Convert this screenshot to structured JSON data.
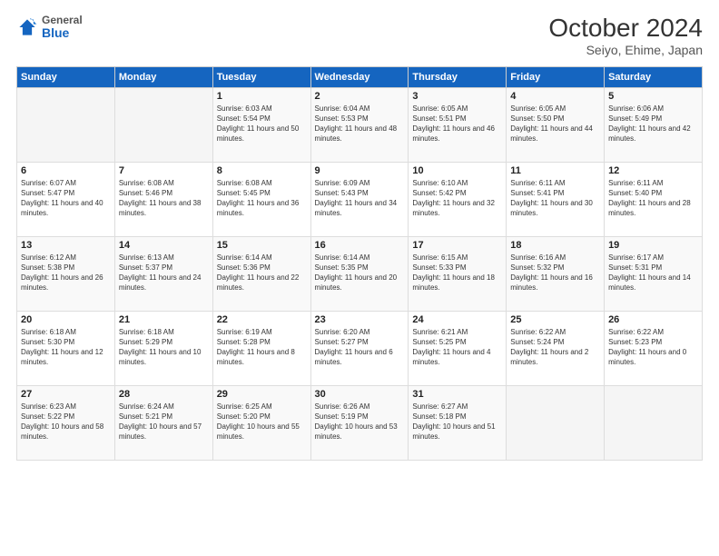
{
  "logo": {
    "general": "General",
    "blue": "Blue"
  },
  "title": "October 2024",
  "subtitle": "Seiyo, Ehime, Japan",
  "weekdays": [
    "Sunday",
    "Monday",
    "Tuesday",
    "Wednesday",
    "Thursday",
    "Friday",
    "Saturday"
  ],
  "weeks": [
    [
      {
        "day": "",
        "sunrise": "",
        "sunset": "",
        "daylight": ""
      },
      {
        "day": "",
        "sunrise": "",
        "sunset": "",
        "daylight": ""
      },
      {
        "day": "1",
        "sunrise": "Sunrise: 6:03 AM",
        "sunset": "Sunset: 5:54 PM",
        "daylight": "Daylight: 11 hours and 50 minutes."
      },
      {
        "day": "2",
        "sunrise": "Sunrise: 6:04 AM",
        "sunset": "Sunset: 5:53 PM",
        "daylight": "Daylight: 11 hours and 48 minutes."
      },
      {
        "day": "3",
        "sunrise": "Sunrise: 6:05 AM",
        "sunset": "Sunset: 5:51 PM",
        "daylight": "Daylight: 11 hours and 46 minutes."
      },
      {
        "day": "4",
        "sunrise": "Sunrise: 6:05 AM",
        "sunset": "Sunset: 5:50 PM",
        "daylight": "Daylight: 11 hours and 44 minutes."
      },
      {
        "day": "5",
        "sunrise": "Sunrise: 6:06 AM",
        "sunset": "Sunset: 5:49 PM",
        "daylight": "Daylight: 11 hours and 42 minutes."
      }
    ],
    [
      {
        "day": "6",
        "sunrise": "Sunrise: 6:07 AM",
        "sunset": "Sunset: 5:47 PM",
        "daylight": "Daylight: 11 hours and 40 minutes."
      },
      {
        "day": "7",
        "sunrise": "Sunrise: 6:08 AM",
        "sunset": "Sunset: 5:46 PM",
        "daylight": "Daylight: 11 hours and 38 minutes."
      },
      {
        "day": "8",
        "sunrise": "Sunrise: 6:08 AM",
        "sunset": "Sunset: 5:45 PM",
        "daylight": "Daylight: 11 hours and 36 minutes."
      },
      {
        "day": "9",
        "sunrise": "Sunrise: 6:09 AM",
        "sunset": "Sunset: 5:43 PM",
        "daylight": "Daylight: 11 hours and 34 minutes."
      },
      {
        "day": "10",
        "sunrise": "Sunrise: 6:10 AM",
        "sunset": "Sunset: 5:42 PM",
        "daylight": "Daylight: 11 hours and 32 minutes."
      },
      {
        "day": "11",
        "sunrise": "Sunrise: 6:11 AM",
        "sunset": "Sunset: 5:41 PM",
        "daylight": "Daylight: 11 hours and 30 minutes."
      },
      {
        "day": "12",
        "sunrise": "Sunrise: 6:11 AM",
        "sunset": "Sunset: 5:40 PM",
        "daylight": "Daylight: 11 hours and 28 minutes."
      }
    ],
    [
      {
        "day": "13",
        "sunrise": "Sunrise: 6:12 AM",
        "sunset": "Sunset: 5:38 PM",
        "daylight": "Daylight: 11 hours and 26 minutes."
      },
      {
        "day": "14",
        "sunrise": "Sunrise: 6:13 AM",
        "sunset": "Sunset: 5:37 PM",
        "daylight": "Daylight: 11 hours and 24 minutes."
      },
      {
        "day": "15",
        "sunrise": "Sunrise: 6:14 AM",
        "sunset": "Sunset: 5:36 PM",
        "daylight": "Daylight: 11 hours and 22 minutes."
      },
      {
        "day": "16",
        "sunrise": "Sunrise: 6:14 AM",
        "sunset": "Sunset: 5:35 PM",
        "daylight": "Daylight: 11 hours and 20 minutes."
      },
      {
        "day": "17",
        "sunrise": "Sunrise: 6:15 AM",
        "sunset": "Sunset: 5:33 PM",
        "daylight": "Daylight: 11 hours and 18 minutes."
      },
      {
        "day": "18",
        "sunrise": "Sunrise: 6:16 AM",
        "sunset": "Sunset: 5:32 PM",
        "daylight": "Daylight: 11 hours and 16 minutes."
      },
      {
        "day": "19",
        "sunrise": "Sunrise: 6:17 AM",
        "sunset": "Sunset: 5:31 PM",
        "daylight": "Daylight: 11 hours and 14 minutes."
      }
    ],
    [
      {
        "day": "20",
        "sunrise": "Sunrise: 6:18 AM",
        "sunset": "Sunset: 5:30 PM",
        "daylight": "Daylight: 11 hours and 12 minutes."
      },
      {
        "day": "21",
        "sunrise": "Sunrise: 6:18 AM",
        "sunset": "Sunset: 5:29 PM",
        "daylight": "Daylight: 11 hours and 10 minutes."
      },
      {
        "day": "22",
        "sunrise": "Sunrise: 6:19 AM",
        "sunset": "Sunset: 5:28 PM",
        "daylight": "Daylight: 11 hours and 8 minutes."
      },
      {
        "day": "23",
        "sunrise": "Sunrise: 6:20 AM",
        "sunset": "Sunset: 5:27 PM",
        "daylight": "Daylight: 11 hours and 6 minutes."
      },
      {
        "day": "24",
        "sunrise": "Sunrise: 6:21 AM",
        "sunset": "Sunset: 5:25 PM",
        "daylight": "Daylight: 11 hours and 4 minutes."
      },
      {
        "day": "25",
        "sunrise": "Sunrise: 6:22 AM",
        "sunset": "Sunset: 5:24 PM",
        "daylight": "Daylight: 11 hours and 2 minutes."
      },
      {
        "day": "26",
        "sunrise": "Sunrise: 6:22 AM",
        "sunset": "Sunset: 5:23 PM",
        "daylight": "Daylight: 11 hours and 0 minutes."
      }
    ],
    [
      {
        "day": "27",
        "sunrise": "Sunrise: 6:23 AM",
        "sunset": "Sunset: 5:22 PM",
        "daylight": "Daylight: 10 hours and 58 minutes."
      },
      {
        "day": "28",
        "sunrise": "Sunrise: 6:24 AM",
        "sunset": "Sunset: 5:21 PM",
        "daylight": "Daylight: 10 hours and 57 minutes."
      },
      {
        "day": "29",
        "sunrise": "Sunrise: 6:25 AM",
        "sunset": "Sunset: 5:20 PM",
        "daylight": "Daylight: 10 hours and 55 minutes."
      },
      {
        "day": "30",
        "sunrise": "Sunrise: 6:26 AM",
        "sunset": "Sunset: 5:19 PM",
        "daylight": "Daylight: 10 hours and 53 minutes."
      },
      {
        "day": "31",
        "sunrise": "Sunrise: 6:27 AM",
        "sunset": "Sunset: 5:18 PM",
        "daylight": "Daylight: 10 hours and 51 minutes."
      },
      {
        "day": "",
        "sunrise": "",
        "sunset": "",
        "daylight": ""
      },
      {
        "day": "",
        "sunrise": "",
        "sunset": "",
        "daylight": ""
      }
    ]
  ]
}
